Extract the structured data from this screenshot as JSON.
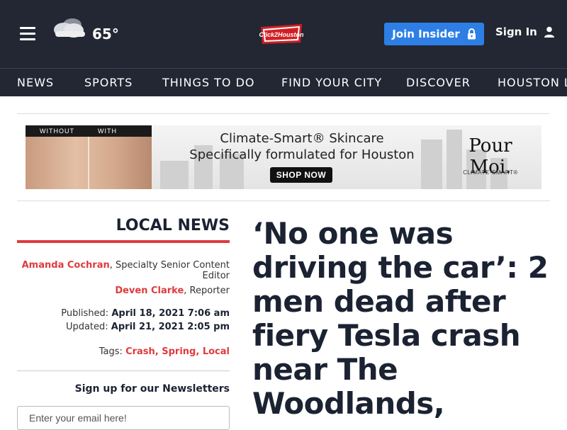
{
  "header": {
    "temperature": "65°",
    "weather_icon": "cloudy-icon",
    "logo_text": "Click2Houston",
    "join_label": "Join Insider",
    "signin_label": "Sign In"
  },
  "nav": {
    "items": [
      "NEWS",
      "SPORTS",
      "THINGS TO DO",
      "FIND YOUR CITY",
      "DISCOVER",
      "HOUSTON LIFE"
    ]
  },
  "ad": {
    "without_label": "WITHOUT",
    "with_label": "WITH",
    "headline": "Climate-Smart® Skincare",
    "subheadline": "Specifically formulated for Houston",
    "cta": "SHOP NOW",
    "brand": "Pour Moi.",
    "brand_sub": "CLIMATE-SMART®"
  },
  "sidebar": {
    "section": "LOCAL NEWS",
    "authors": [
      {
        "name": "Amanda Cochran",
        "role": ", Specialty Senior Content Editor"
      },
      {
        "name": "Deven Clarke",
        "role": ", Reporter"
      }
    ],
    "published_label": "Published:",
    "published_value": "April 18, 2021 7:06 am",
    "updated_label": "Updated:",
    "updated_value": "April 21, 2021 2:05 pm",
    "tags_label": "Tags:",
    "tags": [
      "Crash",
      "Spring",
      "Local"
    ],
    "newsletter_title": "Sign up for our Newsletters",
    "email_placeholder": "Enter your email here!"
  },
  "article": {
    "headline": "‘No one was driving the car’: 2 men dead after fiery Tesla crash near The Woodlands,"
  },
  "colors": {
    "header_bg": "#222733",
    "accent_red": "#e03a3e",
    "join_blue": "#2d7fe6",
    "headline_navy": "#1b2232"
  }
}
